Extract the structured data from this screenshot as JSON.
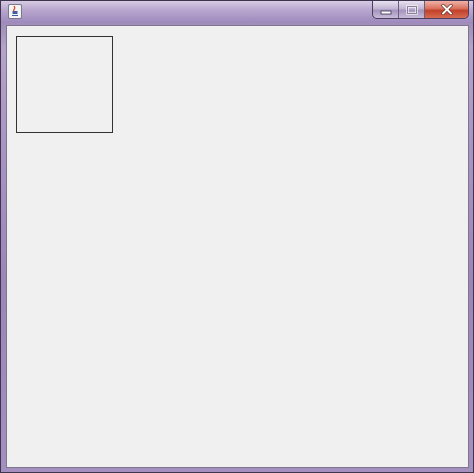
{
  "window": {
    "icon": "java-cup-icon",
    "controls": {
      "minimize_icon": "minimize-icon",
      "maximize_icon": "maximize-icon",
      "close_icon": "close-icon"
    },
    "colors": {
      "client_background": "#f0f0f0",
      "square_border": "#333333",
      "close_button": "#c7432d"
    }
  }
}
